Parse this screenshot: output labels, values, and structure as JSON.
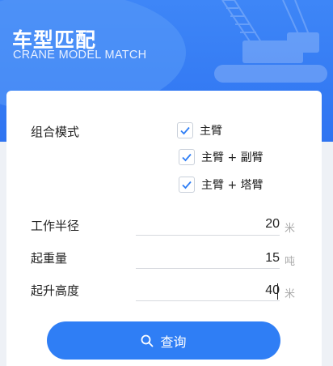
{
  "header": {
    "title_cn": "车型匹配",
    "title_en": "CRANE MODEL MATCH"
  },
  "form": {
    "mode_label": "组合模式",
    "options": [
      {
        "label": "主臂",
        "checked": true
      },
      {
        "label": "主臂 + 副臂",
        "checked": true
      },
      {
        "label": "主臂 + 塔臂",
        "checked": true
      }
    ],
    "radius": {
      "label": "工作半径",
      "value": "20",
      "unit": "米"
    },
    "weight": {
      "label": "起重量",
      "value": "15",
      "unit": "吨"
    },
    "height": {
      "label": "起升高度",
      "value": "40",
      "unit": "米"
    }
  },
  "search_button": {
    "label": "查询",
    "icon": "search-icon"
  },
  "colors": {
    "primary": "#2f7ef5",
    "header": "#3e86f7"
  }
}
